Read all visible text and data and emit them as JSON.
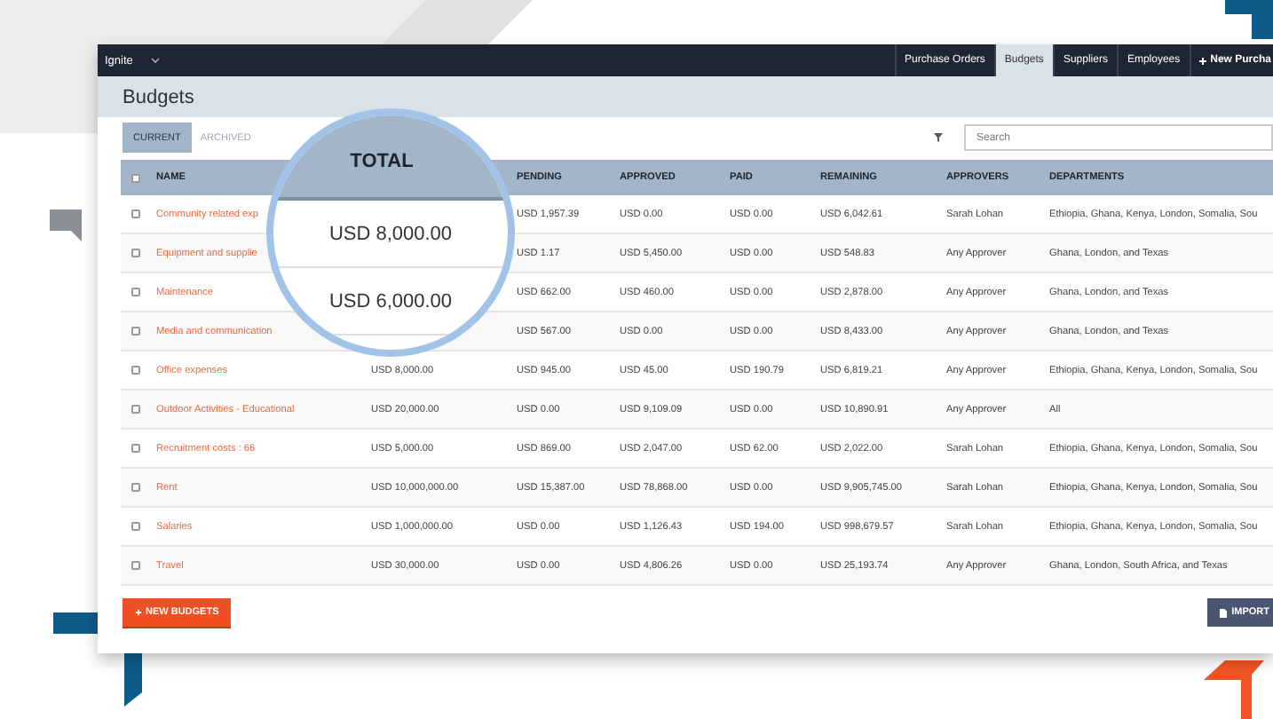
{
  "navbar": {
    "brand": "Ignite",
    "tabs": [
      {
        "label": "Purchase Orders",
        "selected": false
      },
      {
        "label": "Budgets",
        "selected": true
      },
      {
        "label": "Suppliers",
        "selected": false
      },
      {
        "label": "Employees",
        "selected": false
      }
    ],
    "new_button": {
      "label": "New Purcha"
    }
  },
  "page_title": "Budgets",
  "filter_tabs": [
    {
      "label": "CURRENT",
      "selected": true
    },
    {
      "label": "ARCHIVED",
      "selected": false
    }
  ],
  "search": {
    "placeholder": "Search"
  },
  "table": {
    "all_checked": false,
    "columns": [
      "NAME",
      "PENDING",
      "APPROVED",
      "PAID",
      "REMAINING",
      "APPROVERS",
      "DEPARTMENTS"
    ],
    "rows": [
      {
        "checked": false,
        "name": "Community related exp",
        "pending": "USD 1,957.39",
        "approved": "USD 0.00",
        "paid": "USD 0.00",
        "remaining": "USD 6,042.61",
        "approvers": "Sarah Lohan",
        "departments": "Ethiopia, Ghana, Kenya, London, Somalia, Sou"
      },
      {
        "checked": false,
        "name": "Equipment and supplie",
        "pending": "USD 1.17",
        "approved": "USD 5,450.00",
        "paid": "USD 0.00",
        "remaining": "USD 548.83",
        "approvers": "Any Approver",
        "departments": "Ghana, London, and Texas"
      },
      {
        "checked": false,
        "name": "Maintenance",
        "pending": "USD 662.00",
        "approved": "USD 460.00",
        "paid": "USD 0.00",
        "remaining": "USD 2,878.00",
        "approvers": "Any Approver",
        "departments": "Ghana, London, and Texas"
      },
      {
        "checked": false,
        "name": "Media and communication",
        "pending": "USD 567.00",
        "approved": "USD 0.00",
        "paid": "USD 0.00",
        "remaining": "USD 8,433.00",
        "approvers": "Any Approver",
        "departments": "Ghana, London, and Texas"
      },
      {
        "checked": false,
        "name": "Office expenses",
        "total": "USD 8,000.00",
        "pending": "USD 945.00",
        "approved": "USD 45.00",
        "paid": "USD 190.79",
        "remaining": "USD 6,819.21",
        "approvers": "Any Approver",
        "departments": "Ethiopia, Ghana, Kenya, London, Somalia, Sou"
      },
      {
        "checked": false,
        "name": "Outdoor Activities - Educational",
        "total": "USD 20,000.00",
        "pending": "USD 0.00",
        "approved": "USD 9,109.09",
        "paid": "USD 0.00",
        "remaining": "USD 10,890.91",
        "approvers": "Any Approver",
        "departments": "All"
      },
      {
        "checked": false,
        "name": "Recruitment costs : 66",
        "total": "USD 5,000.00",
        "pending": "USD 869.00",
        "approved": "USD 2,047.00",
        "paid": "USD 62.00",
        "remaining": "USD 2,022.00",
        "approvers": "Sarah Lohan",
        "departments": "Ethiopia, Ghana, Kenya, London, Somalia, Sou"
      },
      {
        "checked": false,
        "name": "Rent",
        "total": "USD 10,000,000.00",
        "pending": "USD 15,387.00",
        "approved": "USD 78,868.00",
        "paid": "USD 0.00",
        "remaining": "USD 9,905,745.00",
        "approvers": "Sarah Lohan",
        "departments": "Ethiopia, Ghana, Kenya, London, Somalia, Sou"
      },
      {
        "checked": false,
        "name": "Salaries",
        "total": "USD 1,000,000.00",
        "pending": "USD 0.00",
        "approved": "USD 1,126.43",
        "paid": "USD 194.00",
        "remaining": "USD 998,679.57",
        "approvers": "Sarah Lohan",
        "departments": "Ethiopia, Ghana, Kenya, London, Somalia, Sou"
      },
      {
        "checked": false,
        "name": "Travel",
        "total": "USD 30,000.00",
        "pending": "USD 0.00",
        "approved": "USD 4,806.26",
        "paid": "USD 0.00",
        "remaining": "USD 25,193.74",
        "approvers": "Any Approver",
        "departments": "Ghana, London, South Africa, and Texas"
      }
    ]
  },
  "lens": {
    "header": "TOTAL",
    "values": [
      "USD 8,000.00",
      "USD 6,000.00"
    ]
  },
  "buttons": {
    "new_budgets": {
      "label": "NEW BUDGETS"
    },
    "import": {
      "label": "IMPORT"
    }
  }
}
